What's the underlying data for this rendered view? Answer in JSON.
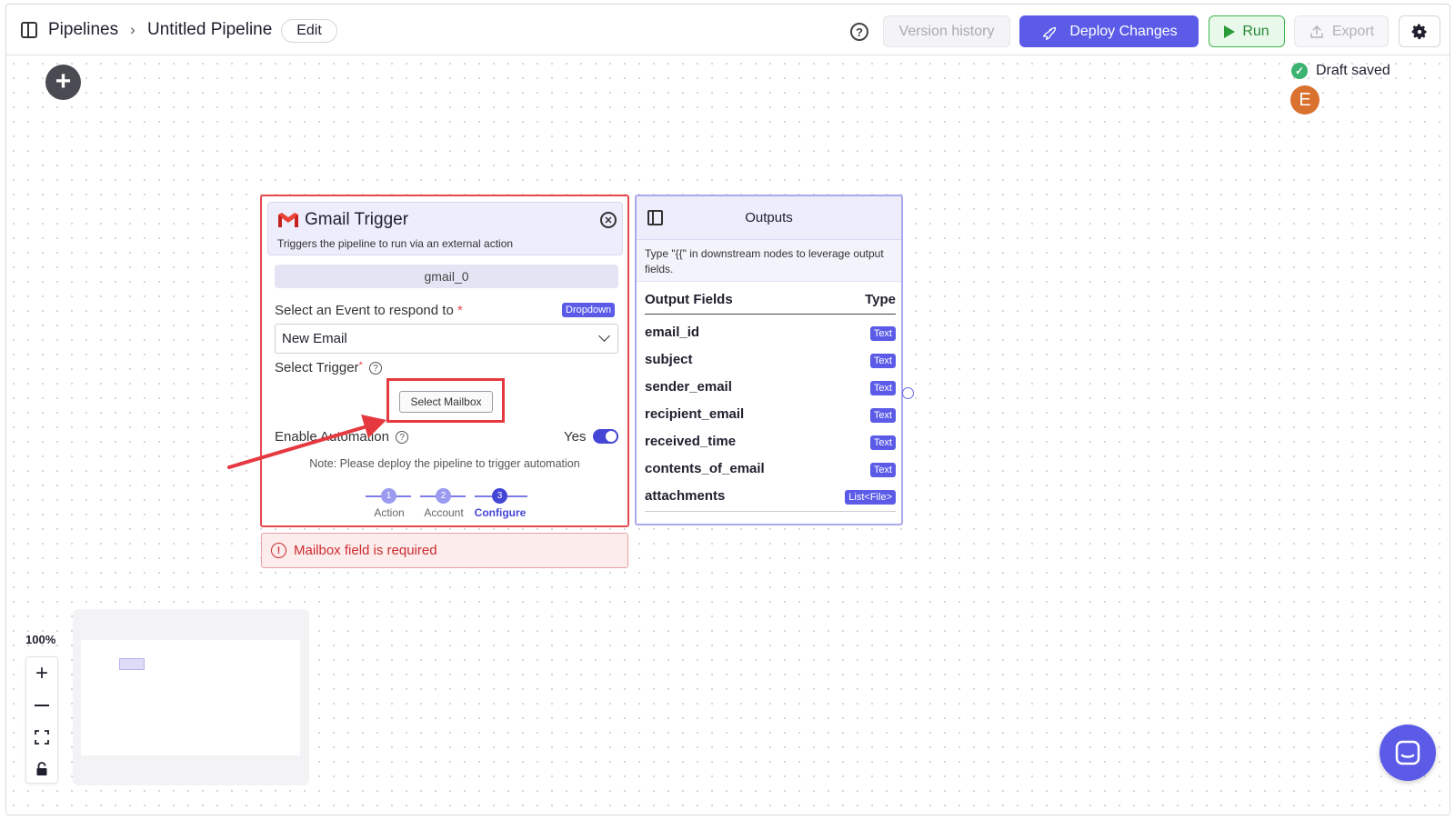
{
  "header": {
    "breadcrumb_root": "Pipelines",
    "breadcrumb_sep": "›",
    "pipeline_name": "Untitled Pipeline",
    "edit_label": "Edit",
    "help_icon": "?",
    "version_history_label": "Version history",
    "deploy_label": "Deploy Changes",
    "run_label": "Run",
    "export_label": "Export"
  },
  "status": {
    "draft_label": "Draft saved",
    "avatar_letter": "E"
  },
  "node": {
    "title": "Gmail Trigger",
    "subtitle": "Triggers the pipeline to run via an external action",
    "id": "gmail_0",
    "event_label": "Select an Event to respond to",
    "event_required": "*",
    "event_type_pill": "Dropdown",
    "event_value": "New Email",
    "trigger_label": "Select Trigger",
    "trigger_required": "*",
    "mailbox_button": "Select Mailbox",
    "automation_label": "Enable Automation",
    "automation_value": "Yes",
    "note": "Note: Please deploy the pipeline to trigger automation",
    "steps": [
      {
        "num": "1",
        "label": "Action"
      },
      {
        "num": "2",
        "label": "Account"
      },
      {
        "num": "3",
        "label": "Configure"
      }
    ]
  },
  "error": {
    "message": "Mailbox field is required"
  },
  "outputs": {
    "title": "Outputs",
    "description": "Type \"{{\" in downstream nodes to leverage output fields.",
    "col_field": "Output Fields",
    "col_type": "Type",
    "fields": [
      {
        "name": "email_id",
        "type": "Text"
      },
      {
        "name": "subject",
        "type": "Text"
      },
      {
        "name": "sender_email",
        "type": "Text"
      },
      {
        "name": "recipient_email",
        "type": "Text"
      },
      {
        "name": "received_time",
        "type": "Text"
      },
      {
        "name": "contents_of_email",
        "type": "Text"
      },
      {
        "name": "attachments",
        "type": "List<File>"
      }
    ]
  },
  "zoom": {
    "level": "100%"
  },
  "colors": {
    "accent": "#5b5be8",
    "error": "#e5484d",
    "success": "#3cb371",
    "avatar": "#d9722e"
  }
}
